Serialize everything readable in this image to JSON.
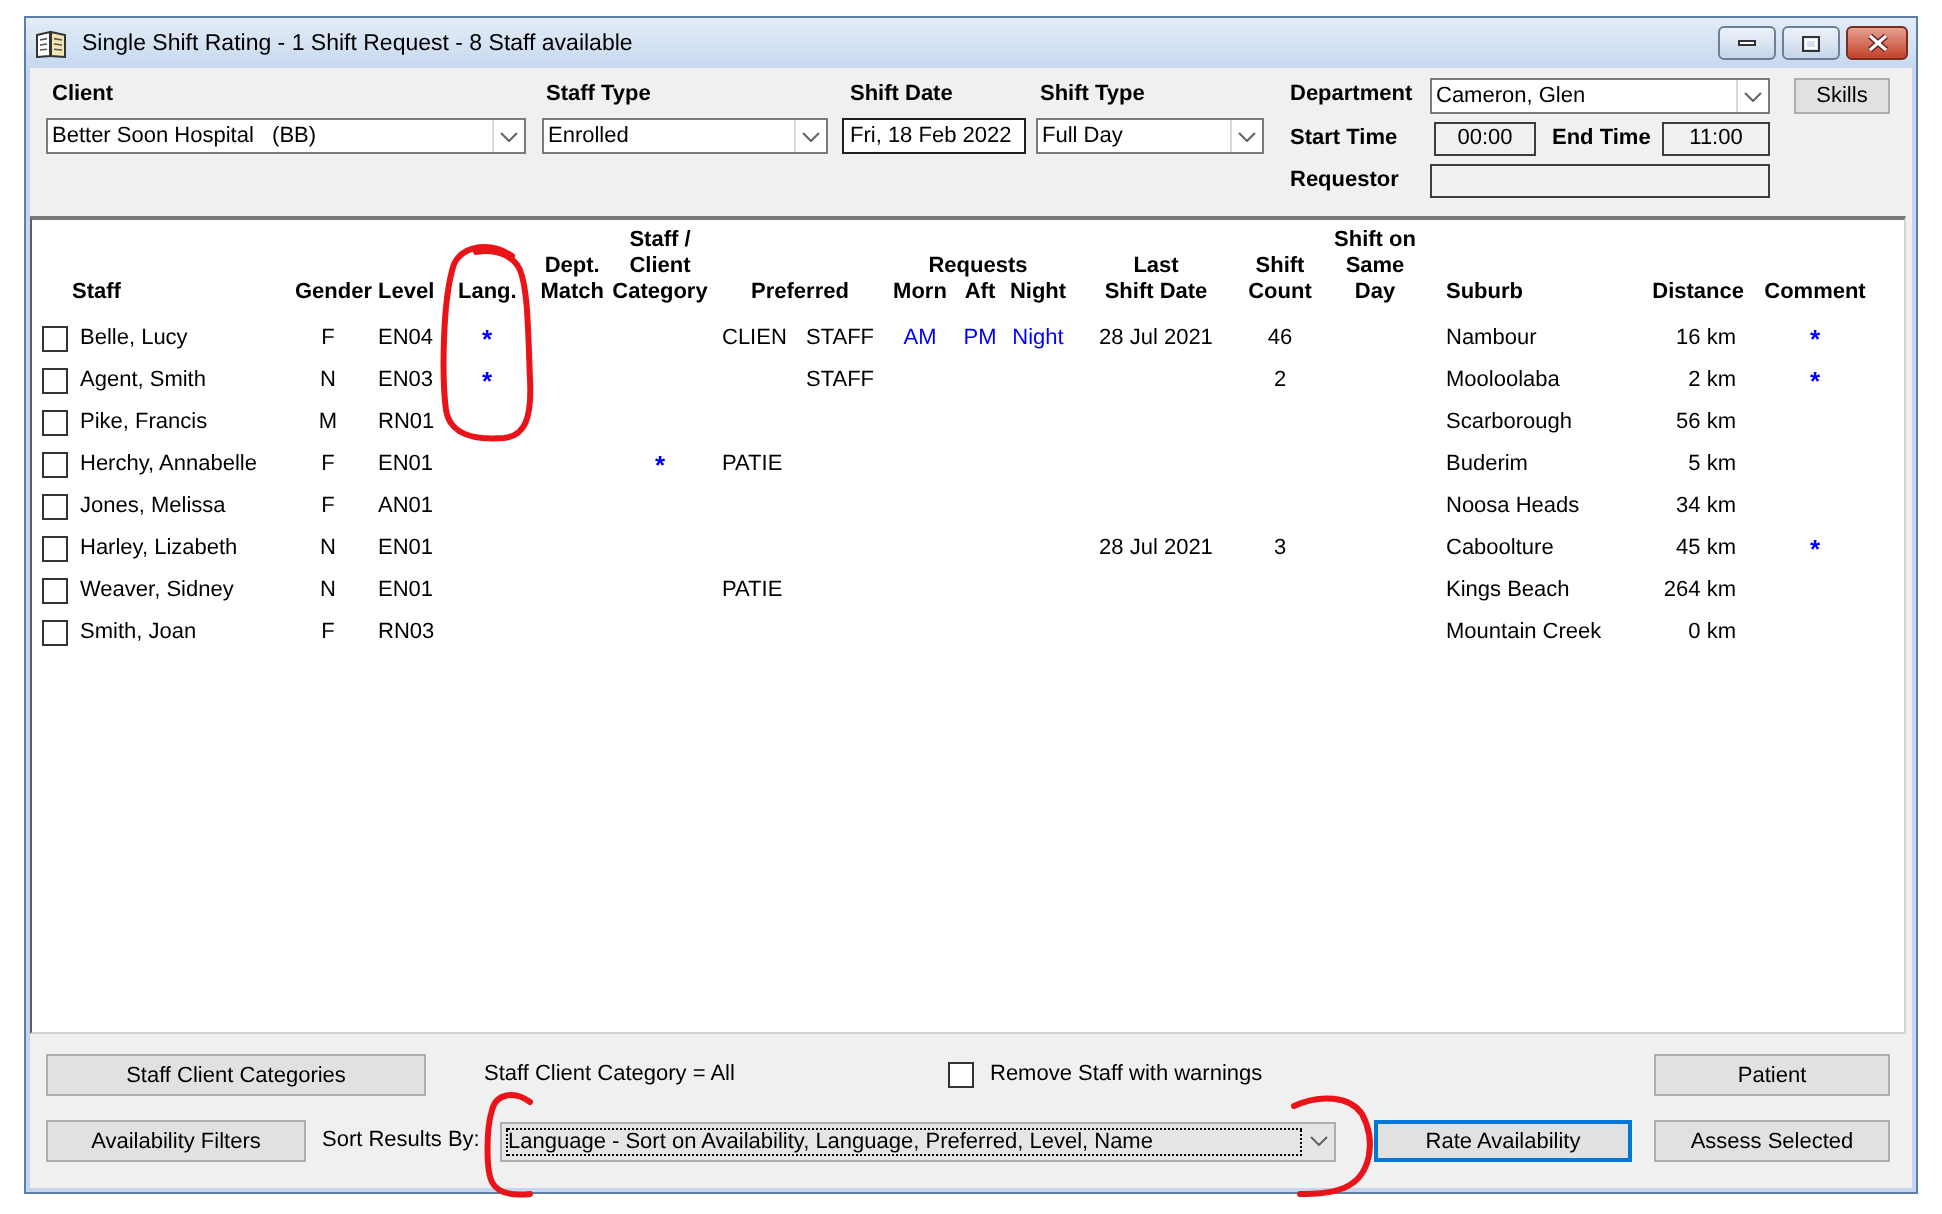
{
  "window": {
    "title": "Single Shift Rating - 1 Shift Request - 8 Staff available"
  },
  "header": {
    "client": {
      "label": "Client",
      "value": "Better Soon Hospital   (BB)"
    },
    "staff_type": {
      "label": "Staff Type",
      "value": "Enrolled"
    },
    "shift_date": {
      "label": "Shift Date",
      "value": "Fri, 18 Feb 2022"
    },
    "shift_type": {
      "label": "Shift Type",
      "value": "Full Day"
    },
    "department": {
      "label": "Department",
      "value": "Cameron, Glen"
    },
    "start_time": {
      "label": "Start Time",
      "value": "00:00"
    },
    "end_time": {
      "label": "End Time",
      "value": "11:00"
    },
    "requestor": {
      "label": "Requestor"
    },
    "skills_button": "Skills"
  },
  "table": {
    "columns": [
      {
        "kind": "single",
        "label": "Staff"
      },
      {
        "kind": "single",
        "label": "Gender"
      },
      {
        "kind": "single",
        "label": "Level"
      },
      {
        "kind": "single",
        "label": "Lang."
      },
      {
        "kind": "single",
        "label": "Dept.\nMatch"
      },
      {
        "kind": "single",
        "label": "Staff /\nClient\nCategory"
      },
      {
        "kind": "single",
        "label": "Preferred"
      },
      {
        "kind": "group",
        "label": "Requests",
        "columns": [
          {
            "label": "Morn"
          },
          {
            "label": "Aft"
          },
          {
            "label": "Night"
          }
        ]
      },
      {
        "kind": "single",
        "label": "Last\nShift Date"
      },
      {
        "kind": "single",
        "label": "Shift\nCount"
      },
      {
        "kind": "single",
        "label": "Shift on\nSame\nDay"
      },
      {
        "kind": "single",
        "label": "Suburb"
      },
      {
        "kind": "single",
        "label": "Distance"
      },
      {
        "kind": "single",
        "label": "Comment"
      }
    ],
    "rows": [
      {
        "checked": false,
        "staff": "Belle, Lucy",
        "gender": "F",
        "level": "EN04",
        "lang": "*",
        "preferred_1": "CLIEN",
        "preferred_2": "STAFF",
        "morn": "AM",
        "aft": "PM",
        "night": "Night",
        "last_shift_date": "28 Jul 2021",
        "shift_count": "46",
        "suburb": "Nambour",
        "distance": "16 km",
        "comment": "*"
      },
      {
        "checked": false,
        "staff": "Agent, Smith",
        "gender": "N",
        "level": "EN03",
        "lang": "*",
        "preferred_2": "STAFF",
        "shift_count": "2",
        "suburb": "Mooloolaba",
        "distance": "2 km",
        "comment": "*"
      },
      {
        "checked": false,
        "staff": "Pike, Francis",
        "gender": "M",
        "level": "RN01",
        "suburb": "Scarborough",
        "distance": "56 km"
      },
      {
        "checked": false,
        "staff": "Herchy, Annabelle",
        "gender": "F",
        "level": "EN01",
        "category": "*",
        "preferred_1": "PATIE",
        "suburb": "Buderim",
        "distance": "5 km"
      },
      {
        "checked": false,
        "staff": "Jones, Melissa",
        "gender": "F",
        "level": "AN01",
        "suburb": "Noosa Heads",
        "distance": "34 km"
      },
      {
        "checked": false,
        "staff": "Harley, Lizabeth",
        "gender": "N",
        "level": "EN01",
        "last_shift_date": "28 Jul 2021",
        "shift_count": "3",
        "suburb": "Caboolture",
        "distance": "45 km",
        "comment": "*"
      },
      {
        "checked": false,
        "staff": "Weaver, Sidney",
        "gender": "N",
        "level": "EN01",
        "preferred_1": "PATIE",
        "suburb": "Kings Beach",
        "distance": "264 km"
      },
      {
        "checked": false,
        "staff": "Smith, Joan",
        "gender": "F",
        "level": "RN03",
        "suburb": "Mountain Creek",
        "distance": "0 km"
      }
    ]
  },
  "footer": {
    "categories_button": "Staff Client Categories",
    "category_filter": "Staff Client Category = All",
    "remove_warnings": {
      "label": "Remove Staff with warnings",
      "checked": false
    },
    "patient_button": "Patient",
    "availability_button": "Availability Filters",
    "sort": {
      "label": "Sort Results By:",
      "value": "Language - Sort on Availability, Language, Preferred, Level, Name",
      "focused": true
    },
    "rate_button": {
      "label": "Rate Availability",
      "default": true
    },
    "assess_button": "Assess Selected"
  }
}
